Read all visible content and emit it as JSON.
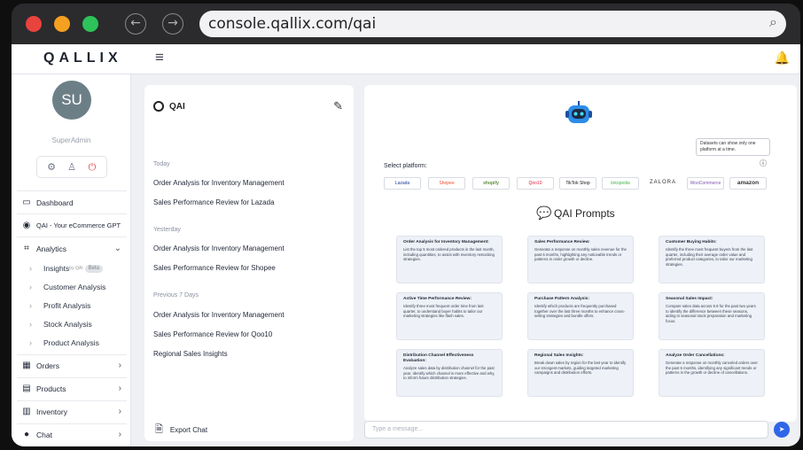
{
  "browser": {
    "url": "console.qallix.com/qai",
    "colors": {
      "close": "#e8433d",
      "min": "#f5a020",
      "max": "#2ec25a"
    }
  },
  "app": {
    "logo": "QALLIX",
    "user": {
      "initials": "SU",
      "name": "SuperAdmin"
    },
    "sidebar": {
      "items": [
        {
          "label": "Dashboard",
          "icon": "monitor-icon"
        },
        {
          "label": "QAI - Your eCommerce GPT",
          "icon": "qai-icon"
        },
        {
          "label": "Analytics",
          "icon": "chart-icon"
        }
      ],
      "analytics_sub": [
        {
          "label": "Insights",
          "sup": "by QAI",
          "badge": "Beta"
        },
        {
          "label": "Customer Analysis"
        },
        {
          "label": "Profit Analysis"
        },
        {
          "label": "Stock Analysis"
        },
        {
          "label": "Product Analysis"
        }
      ],
      "bottom_items": [
        {
          "label": "Orders",
          "icon": "orders-icon"
        },
        {
          "label": "Products",
          "icon": "products-icon"
        },
        {
          "label": "Inventory",
          "icon": "inventory-icon"
        },
        {
          "label": "Chat",
          "icon": "chat-icon"
        }
      ]
    },
    "chat": {
      "title": "QAI",
      "groups": [
        {
          "label": "Today",
          "items": [
            "Order Analysis for Inventory Management",
            "Sales Performance Review for Lazada"
          ]
        },
        {
          "label": "Yesterday",
          "items": [
            "Order Analysis for Inventory Management",
            "Sales Performance Review for Shopee"
          ]
        },
        {
          "label": "Previous 7 Days",
          "items": [
            "Order Analysis for Inventory Management",
            "Sales Performance Review for Qoo10",
            "Regional Sales Insights"
          ]
        }
      ],
      "export_label": "Export Chat"
    },
    "main": {
      "note": "Datasets can show only one platform at a time.",
      "select_label": "Select platform:",
      "platforms": [
        "Lazada",
        "Shopee",
        "shopify",
        "Qoo10",
        "TikTok Shop",
        "tokopedia",
        "ZALORA",
        "WooCommerce",
        "amazon"
      ],
      "prompts_title": "QAI Prompts",
      "cards": [
        {
          "title": "Order Analysis for Inventory Management:",
          "desc": "List the top 5 most ordered products in the last month, including quantities, to assist with inventory restocking strategies."
        },
        {
          "title": "Sales Performance Review:",
          "desc": "Generate a response on monthly sales revenue for the past 6 months, highlighting any noticeable trends or patterns in order growth or decline."
        },
        {
          "title": "Customer Buying Habits:",
          "desc": "Identify the three most frequent buyers from the last quarter, including their average order value and preferred product categories, to tailor our marketing strategies."
        },
        {
          "title": "Active Time Performance Review:",
          "desc": "Identify three most frequent order time from last quarter, to understand buyer habits to tailor our marketing strategies like flash sales."
        },
        {
          "title": "Purchase Pattern Analysis:",
          "desc": "Identify which products are frequently purchased together over the last three months to enhance cross-selling strategies and bundle offers."
        },
        {
          "title": "Seasonal Sales Impact:",
          "desc": "Compare sales data across 9.9 for the past two years to identify the difference between these seasons, aiding in seasonal stock preparation and marketing focus."
        },
        {
          "title": "Distribution Channel Effectiveness Evaluation:",
          "desc": "Analyze sales data by distribution channel for the past year. Identify which channel is more effective and why, to inform future distribution strategies."
        },
        {
          "title": "Regional Sales Insights:",
          "desc": "Break down sales by region for the last year to identify our strongest markets, guiding targeted marketing campaigns and distribution efforts."
        },
        {
          "title": "Analyze Order Cancellations:",
          "desc": "Generate a response on monthly canceled orders over the past 6 months, identifying any significant trends or patterns in the growth or decline of cancellations."
        }
      ],
      "message_placeholder": "Type a message..."
    }
  }
}
